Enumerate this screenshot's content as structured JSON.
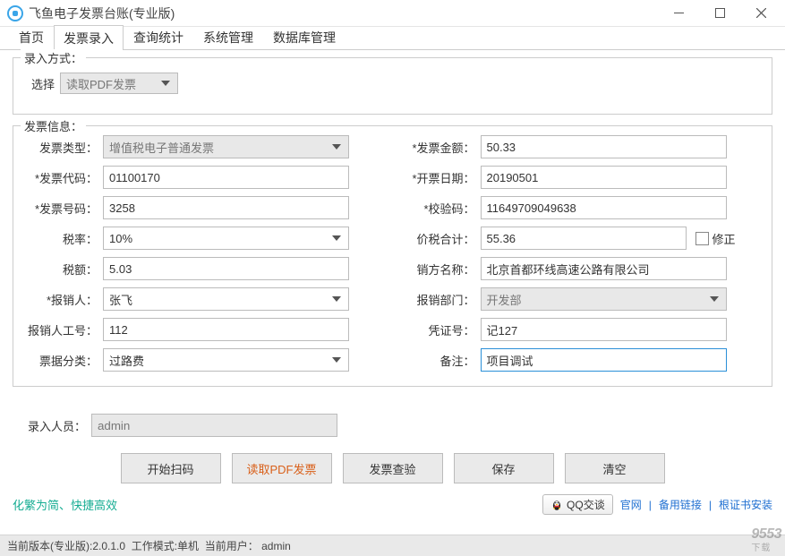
{
  "window": {
    "title": "飞鱼电子发票台账(专业版)"
  },
  "tabs": [
    "首页",
    "发票录入",
    "查询统计",
    "系统管理",
    "数据库管理"
  ],
  "active_tab": "发票录入",
  "entry_mode": {
    "legend": "录入方式：",
    "select_label": "选择",
    "selected": "读取PDF发票"
  },
  "invoice": {
    "legend": "发票信息：",
    "fields": {
      "type_label": "发票类型：",
      "type_value": "增值税电子普通发票",
      "code_label": "*发票代码：",
      "code_value": "01100170",
      "number_label": "*发票号码：",
      "number_value": "3258",
      "tax_rate_label": "税率：",
      "tax_rate_value": "10%",
      "tax_amount_label": "税额：",
      "tax_amount_value": "5.03",
      "reimburser_label": "*报销人：",
      "reimburser_value": "张飞",
      "emp_no_label": "报销人工号：",
      "emp_no_value": "112",
      "category_label": "票据分类：",
      "category_value": "过路费",
      "amount_label": "*发票金额：",
      "amount_value": "50.33",
      "date_label": "*开票日期：",
      "date_value": "20190501",
      "check_label": "*校验码：",
      "check_value": "11649709049638",
      "total_label": "价税合计：",
      "total_value": "55.36",
      "correction_label": "修正",
      "seller_label": "销方名称：",
      "seller_value": "北京首都环线高速公路有限公司",
      "dept_label": "报销部门：",
      "dept_value": "开发部",
      "voucher_label": "凭证号：",
      "voucher_value": "记127",
      "remark_label": "备注：",
      "remark_value": "项目调试"
    }
  },
  "operator": {
    "label": "录入人员：",
    "value": "admin"
  },
  "buttons": {
    "scan": "开始扫码",
    "read_pdf": "读取PDF发票",
    "verify": "发票查验",
    "save": "保存",
    "clear": "清空"
  },
  "footer": {
    "slogan": "化繁为简、快捷高效",
    "qq": "QQ交谈",
    "links": [
      "官网",
      "备用链接",
      "根证书安装"
    ]
  },
  "status": {
    "version_label": "当前版本(专业版):",
    "version": "2.0.1.0",
    "mode_label": "工作模式:",
    "mode": "单机",
    "user_label": "当前用户：",
    "user": "admin"
  },
  "watermark": {
    "main": "9553",
    "sub": "下载"
  }
}
